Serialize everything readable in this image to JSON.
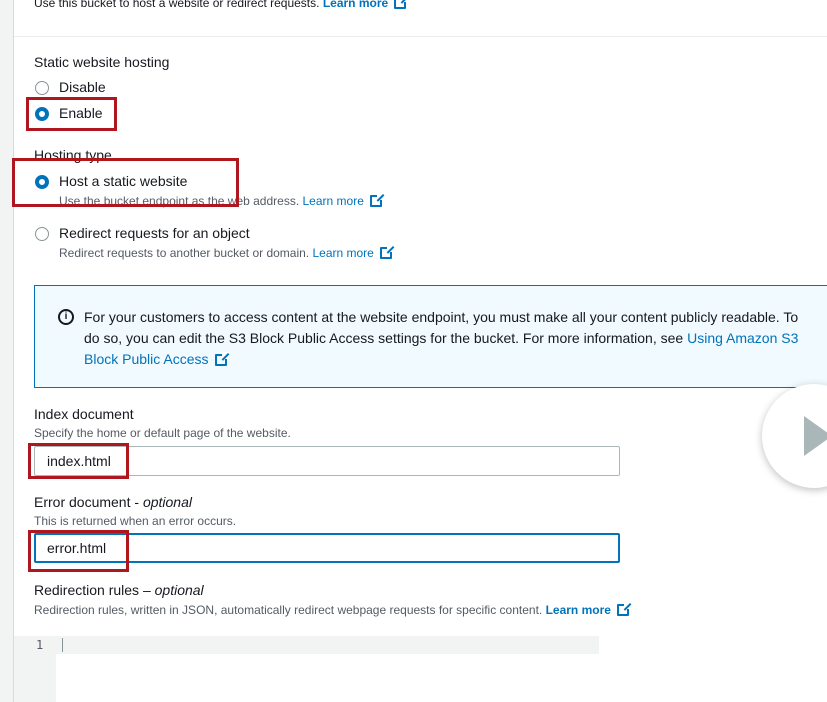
{
  "top_description": {
    "text": "Use this bucket to host a website or redirect requests.",
    "link": "Learn more"
  },
  "static_hosting": {
    "label": "Static website hosting",
    "options": [
      "Disable",
      "Enable"
    ],
    "selected": "Enable"
  },
  "hosting_type": {
    "label": "Hosting type",
    "options": [
      {
        "label": "Host a static website",
        "desc": "Use the bucket endpoint as the web address.",
        "link": "Learn more"
      },
      {
        "label": "Redirect requests for an object",
        "desc": "Redirect requests to another bucket or domain.",
        "link": "Learn more"
      }
    ],
    "selected": "Host a static website"
  },
  "info_alert": {
    "text": "For your customers to access content at the website endpoint, you must make all your content publicly readable. To do so, you can edit the S3 Block Public Access settings for the bucket. For more information, see",
    "link": "Using Amazon S3 Block Public Access"
  },
  "index_document": {
    "label": "Index document",
    "desc": "Specify the home or default page of the website.",
    "value": "index.html"
  },
  "error_document": {
    "label": "Error document -",
    "label_optional": "optional",
    "desc": "This is returned when an error occurs.",
    "value": "error.html"
  },
  "redirection_rules": {
    "label": "Redirection rules –",
    "label_optional": "optional",
    "desc": "Redirection rules, written in JSON, automatically redirect webpage requests for specific content.",
    "link": "Learn more",
    "line_number": "1"
  },
  "colors": {
    "accent": "#0073bb",
    "highlight": "#b0161d",
    "info_bg": "#f1faff"
  },
  "icons": [
    "external-link-icon",
    "info-icon",
    "play-icon"
  ]
}
